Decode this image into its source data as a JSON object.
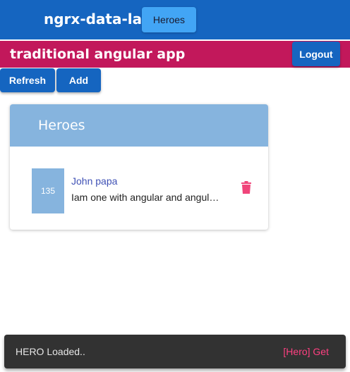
{
  "header": {
    "title": "ngrx-data-lab",
    "nav_heroes_label": "Heroes"
  },
  "subheader": {
    "title": "traditional angular app",
    "logout_label": "Logout"
  },
  "actions": {
    "refresh_label": "Refresh",
    "add_label": "Add"
  },
  "card": {
    "title": "Heroes",
    "heroes": [
      {
        "id": "135",
        "name": "John papa",
        "description": "Iam one with angular and angul…",
        "delete_icon": "trash-icon"
      }
    ]
  },
  "snackbar": {
    "message": "HERO Loaded..",
    "action": "[Hero] Get"
  },
  "colors": {
    "primary": "#1565c0",
    "accent_bar": "#c2185b",
    "nav_button": "#42a5f5",
    "card_header": "#86b4de",
    "delete": "#f0457a",
    "snack_action": "#ff4081"
  }
}
